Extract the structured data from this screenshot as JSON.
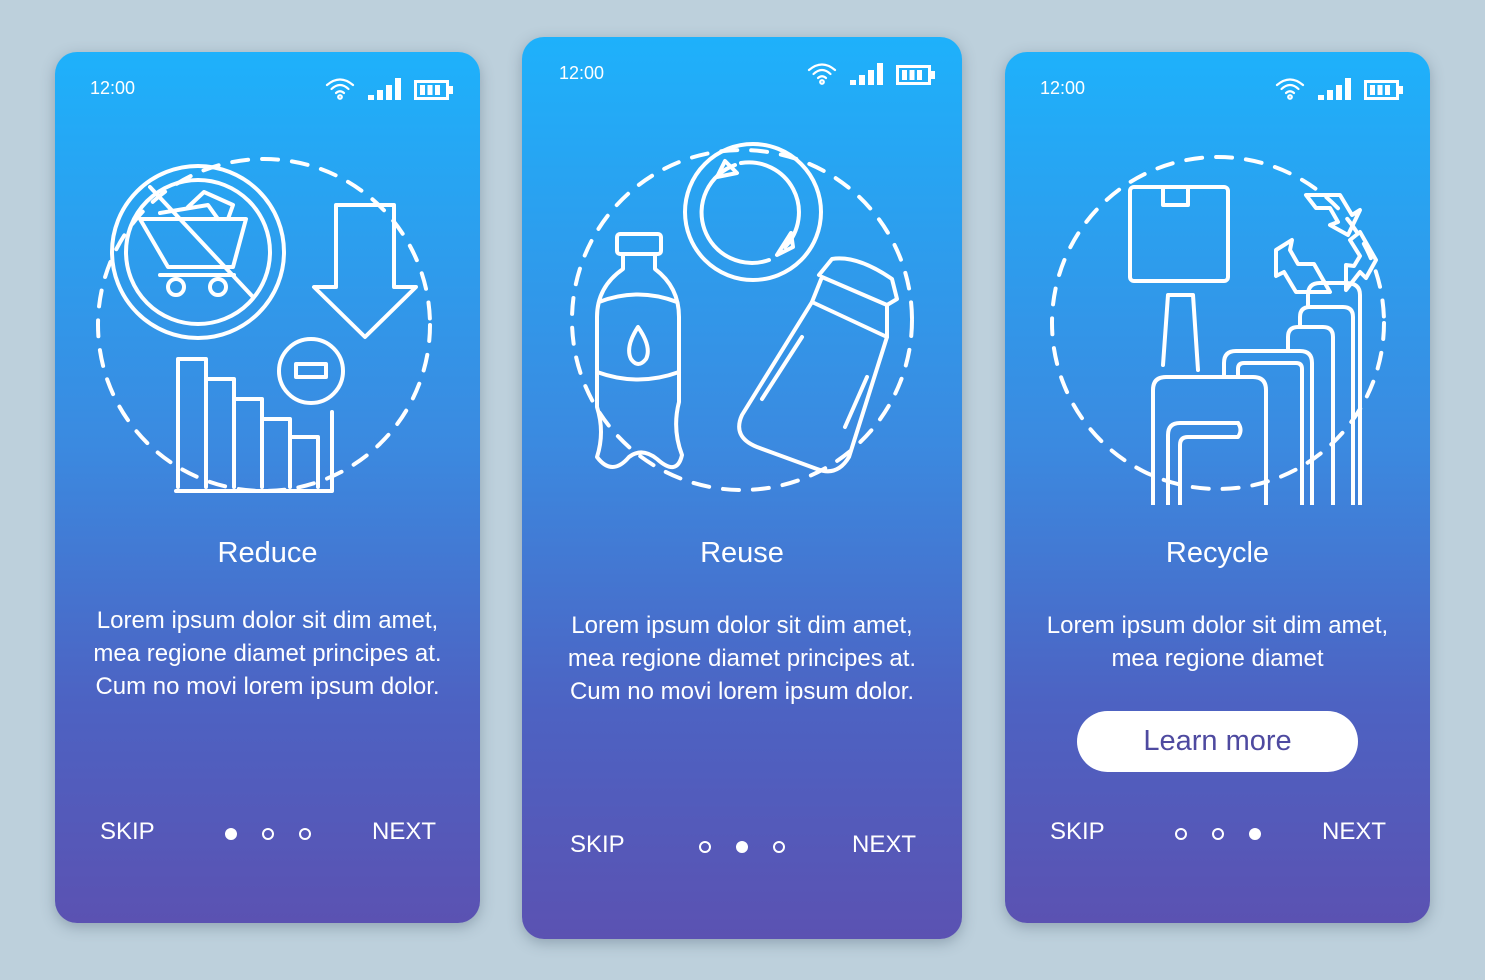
{
  "screens": [
    {
      "status": {
        "time": "12:00",
        "icons": [
          "wifi-icon",
          "signal-icon",
          "battery-icon"
        ]
      },
      "illustration": "reduce-illustration",
      "title": "Reduce",
      "body": "Lorem ipsum dolor sit dim amet, mea regione diamet principes at. Cum no movi lorem ipsum dolor.",
      "skip_label": "SKIP",
      "next_label": "NEXT",
      "page_indicator": {
        "total": 3,
        "active": 1
      }
    },
    {
      "status": {
        "time": "12:00",
        "icons": [
          "wifi-icon",
          "signal-icon",
          "battery-icon"
        ]
      },
      "illustration": "reuse-illustration",
      "title": "Reuse",
      "body": "Lorem ipsum dolor sit dim amet, mea regione diamet principes at. Cum no movi lorem ipsum dolor.",
      "skip_label": "SKIP",
      "next_label": "NEXT",
      "page_indicator": {
        "total": 3,
        "active": 2
      }
    },
    {
      "status": {
        "time": "12:00",
        "icons": [
          "wifi-icon",
          "signal-icon",
          "battery-icon"
        ]
      },
      "illustration": "recycle-illustration",
      "title": "Recycle",
      "body": "Lorem ipsum dolor sit dim amet, mea regione diamet",
      "button_label": "Learn more",
      "skip_label": "SKIP",
      "next_label": "NEXT",
      "page_indicator": {
        "total": 3,
        "active": 3
      }
    }
  ],
  "colors": {
    "gradient_top": "#1eb1fb",
    "gradient_mid": "#3b8ae0",
    "gradient_bottom": "#5b52b2",
    "background": "#bdd0dc",
    "button_text": "#4e4aa0"
  }
}
